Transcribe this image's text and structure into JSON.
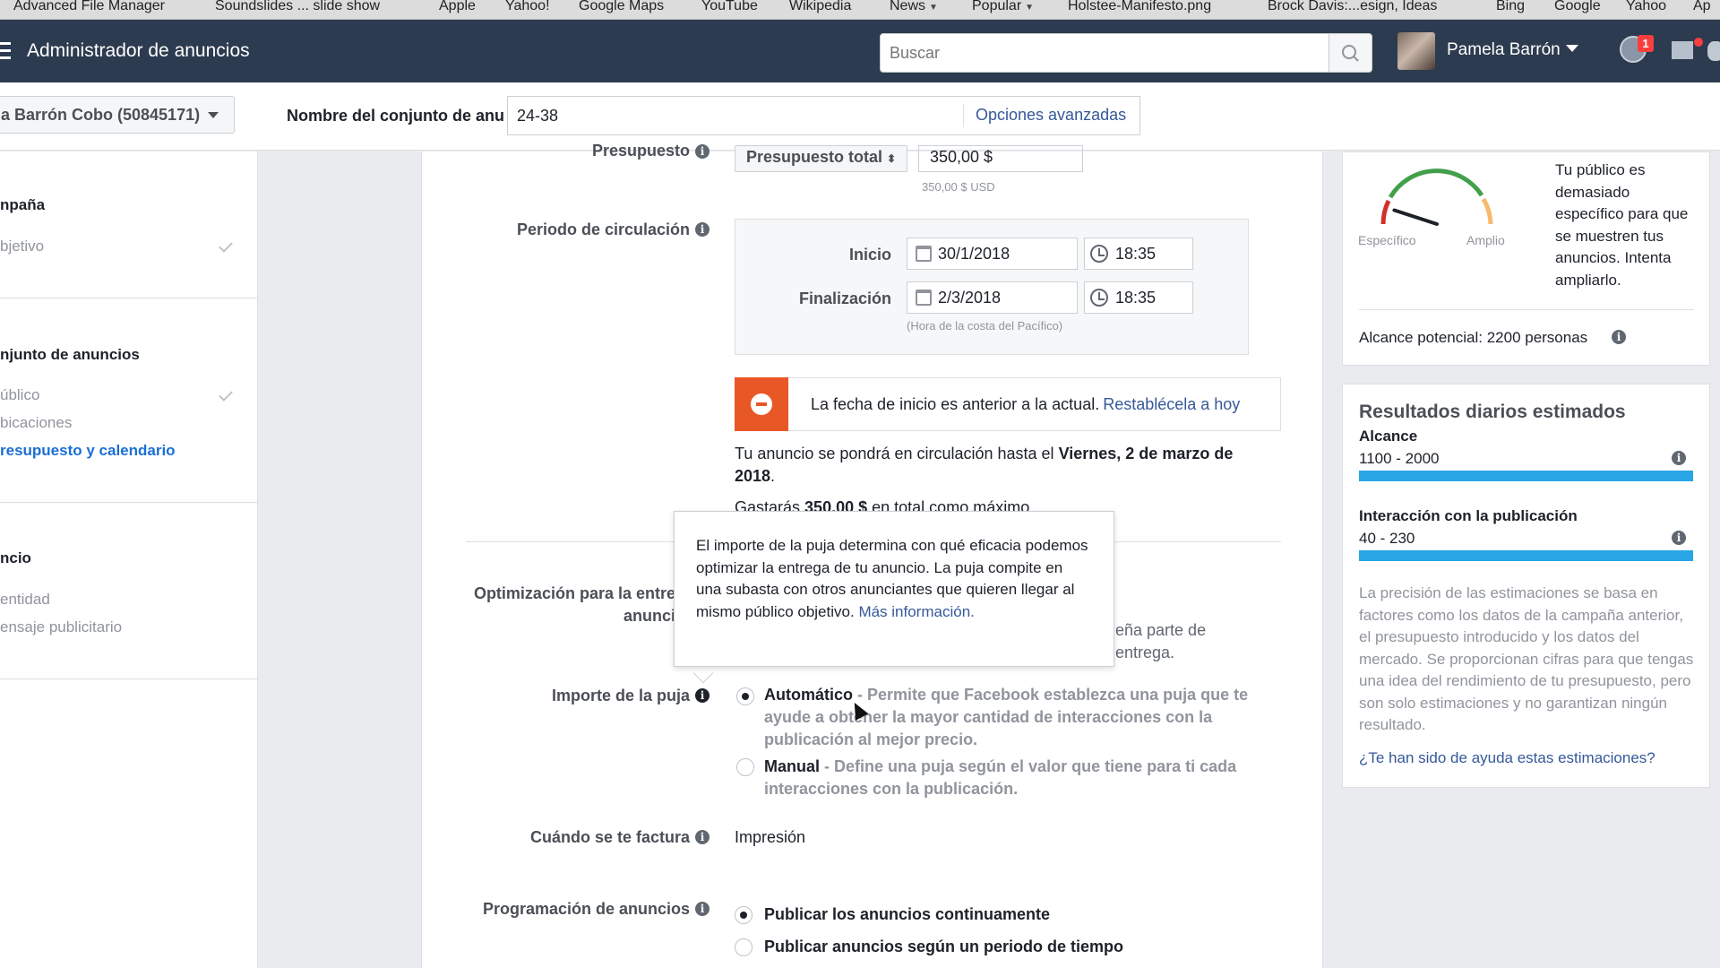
{
  "bookmarks": [
    {
      "label": "Advanced File Manager",
      "dropdown": false
    },
    {
      "label": "Soundslides ... slide show",
      "dropdown": false
    },
    {
      "label": "Apple",
      "dropdown": false
    },
    {
      "label": "Yahoo!",
      "dropdown": false
    },
    {
      "label": "Google Maps",
      "dropdown": false
    },
    {
      "label": "YouTube",
      "dropdown": false
    },
    {
      "label": "Wikipedia",
      "dropdown": false
    },
    {
      "label": "News",
      "dropdown": true
    },
    {
      "label": "Popular",
      "dropdown": true
    },
    {
      "label": "Holstee-Manifesto.png",
      "dropdown": false
    },
    {
      "label": "Brock Davis:...esign, Ideas",
      "dropdown": false
    },
    {
      "label": "Bing",
      "dropdown": false
    },
    {
      "label": "Google",
      "dropdown": false
    },
    {
      "label": "Yahoo",
      "dropdown": false
    },
    {
      "label": "Ap",
      "dropdown": false
    }
  ],
  "header": {
    "title": "Administrador de anuncios",
    "search_placeholder": "Buscar",
    "user_name": "Pamela Barrón",
    "notification_count": "1"
  },
  "subbar": {
    "account": "a Barrón Cobo (50845171)",
    "ad_set_name_label": "Nombre del conjunto de anu",
    "ad_set_name_value": "24-38",
    "advanced_options": "Opciones avanzadas"
  },
  "sidebar": {
    "sections": [
      {
        "title": "npaña",
        "items": [
          {
            "label": "bjetivo",
            "done": true,
            "active": false
          }
        ]
      },
      {
        "title": "njunto de anuncios",
        "items": [
          {
            "label": "úblico",
            "done": true,
            "active": false
          },
          {
            "label": "bicaciones",
            "done": false,
            "active": false
          },
          {
            "label": "resupuesto y calendario",
            "done": false,
            "active": true
          }
        ]
      },
      {
        "title": "ncio",
        "items": [
          {
            "label": "entidad",
            "done": false,
            "active": false
          },
          {
            "label": "ensaje publicitario",
            "done": false,
            "active": false
          }
        ]
      }
    ]
  },
  "budget": {
    "label": "Presupuesto",
    "type": "Presupuesto total",
    "value": "350,00 $",
    "usd_note": "350,00 $ USD"
  },
  "schedule": {
    "label": "Periodo de circulación",
    "start_label": "Inicio",
    "start_date": "30/1/2018",
    "start_time": "18:35",
    "end_label": "Finalización",
    "end_date": "2/3/2018",
    "end_time": "18:35",
    "timezone_note": "(Hora de la costa del Pacífico)"
  },
  "error": {
    "text": "La fecha de inicio es anterior a la actual.",
    "link": "Restablécela a hoy"
  },
  "runtime": {
    "prefix": "Tu anuncio se pondrá en circulación hasta el",
    "date": "Viernes, 2 de marzo de 2018",
    "suffix": "."
  },
  "spend": {
    "prefix": "Gastarás",
    "amount": "350,00 $",
    "suffix": "en total como máximo."
  },
  "optimization": {
    "label_line1": "Optimización para la entre",
    "label_line2": "anunci",
    "desc_line1": "eña parte de",
    "desc_line2": "entrega."
  },
  "tooltip": {
    "text": "El importe de la puja determina con qué eficacia podemos optimizar la entrega de tu anuncio. La puja compite en una subasta con otros anunciantes que quieren llegar al mismo público objetivo.",
    "link": "Más información."
  },
  "bid": {
    "label": "Importe de la puja",
    "options": [
      {
        "title": "Automático",
        "desc": " - Permite que Facebook establezca una puja que te ayude a obtener la mayor cantidad de interacciones con la publicación al mejor precio.",
        "selected": true
      },
      {
        "title": "Manual",
        "desc": " - Define una puja según el valor que tiene para ti cada interacciones con la publicación.",
        "selected": false
      }
    ]
  },
  "billing": {
    "label": "Cuándo se te factura",
    "value": "Impresión"
  },
  "delivery": {
    "label": "Programación de anuncios",
    "options": [
      {
        "title": "Publicar los anuncios continuamente",
        "selected": true
      },
      {
        "title": "Publicar anuncios según un periodo de tiempo",
        "selected": false
      }
    ]
  },
  "audience": {
    "gauge_specific": "Específico",
    "gauge_broad": "Amplio",
    "gauge_level": 0.1,
    "description": "Tu público es demasiado específico para que se muestren tus anuncios. Intenta ampliarlo.",
    "potential_reach": "Alcance potencial: 2200 personas"
  },
  "results": {
    "title": "Resultados diarios estimados",
    "metrics": [
      {
        "label": "Alcance",
        "value": "1100 - 2000",
        "fill": 1.0
      },
      {
        "label": "Interacción con la publicación",
        "value": "40 - 230",
        "fill": 1.0
      }
    ],
    "disclaimer": "La precisión de las estimaciones se basa en factores como los datos de la campaña anterior, el presupuesto introducido y los datos del mercado. Se proporcionan cifras para que tengas una idea del rendimiento de tu presupuesto, pero son solo estimaciones y no garantizan ningún resultado.",
    "feedback_link": "¿Te han sido de ayuda estas estimaciones?"
  },
  "colors": {
    "topbar": "#2c3b4f",
    "link": "#365899",
    "error": "#e85726",
    "result_bar": "#29a6e6",
    "sidebar_active": "#1a6fd4"
  }
}
